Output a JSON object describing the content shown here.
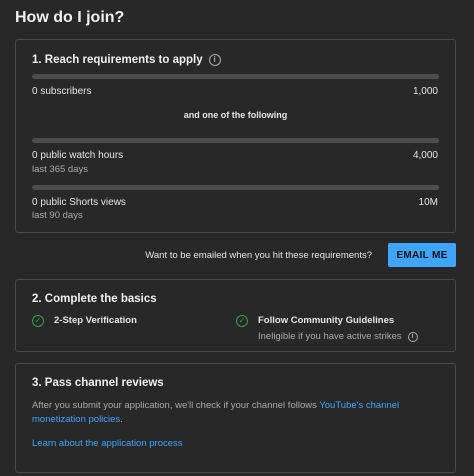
{
  "page": {
    "title": "How do I join?"
  },
  "requirements": {
    "heading": "1. Reach requirements to apply",
    "subscribers": {
      "label": "0 subscribers",
      "target": "1,000",
      "progress": 0
    },
    "divider": "and one of the following",
    "watch_hours": {
      "label": "0 public watch hours",
      "target": "4,000",
      "sub": "last 365 days",
      "progress": 0
    },
    "shorts_views": {
      "label": "0 public Shorts views",
      "target": "10M",
      "sub": "last 90 days",
      "progress": 0
    }
  },
  "email": {
    "prompt": "Want to be emailed when you hit these requirements?",
    "button_label": "EMAIL ME"
  },
  "basics": {
    "heading": "2. Complete the basics",
    "items": [
      {
        "title": "2-Step Verification",
        "sub": ""
      },
      {
        "title": "Follow Community Guidelines",
        "sub": "Ineligible if you have active strikes"
      }
    ]
  },
  "reviews": {
    "heading": "3. Pass channel reviews",
    "text": "After you submit your application, we'll check if your channel follows ",
    "policy_link": "YouTube's channel monetization policies",
    "text_end": ".",
    "learn_link": "Learn about the application process"
  },
  "colors": {
    "accent": "#3ea6ff",
    "check": "#2ba640",
    "background": "#282828"
  }
}
